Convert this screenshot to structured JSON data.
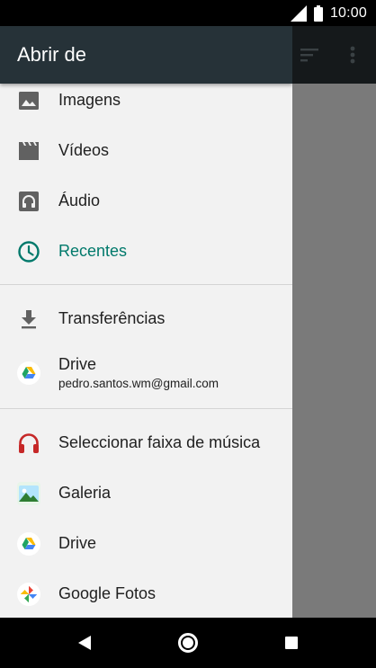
{
  "status_bar": {
    "time": "10:00"
  },
  "drawer": {
    "title": "Abrir de",
    "items": [
      {
        "label": "Imagens",
        "icon": "image-icon"
      },
      {
        "label": "Vídeos",
        "icon": "video-icon"
      },
      {
        "label": "Áudio",
        "icon": "audio-icon"
      },
      {
        "label": "Recentes",
        "icon": "clock-icon",
        "active": true
      },
      {
        "label": "Transferências",
        "icon": "download-icon"
      },
      {
        "label": "Drive",
        "sublabel": "pedro.santos.wm@gmail.com",
        "icon": "google-drive-icon"
      },
      {
        "label": "Seleccionar faixa de música",
        "icon": "headphones-icon"
      },
      {
        "label": "Galeria",
        "icon": "gallery-icon"
      },
      {
        "label": "Drive",
        "icon": "google-drive-icon"
      },
      {
        "label": "Google Fotos",
        "icon": "google-photos-icon"
      }
    ]
  },
  "colors": {
    "header": "#263238",
    "accent": "#00796b",
    "drawer_bg": "#f2f2f2",
    "scrim": "#7a7a7a"
  }
}
